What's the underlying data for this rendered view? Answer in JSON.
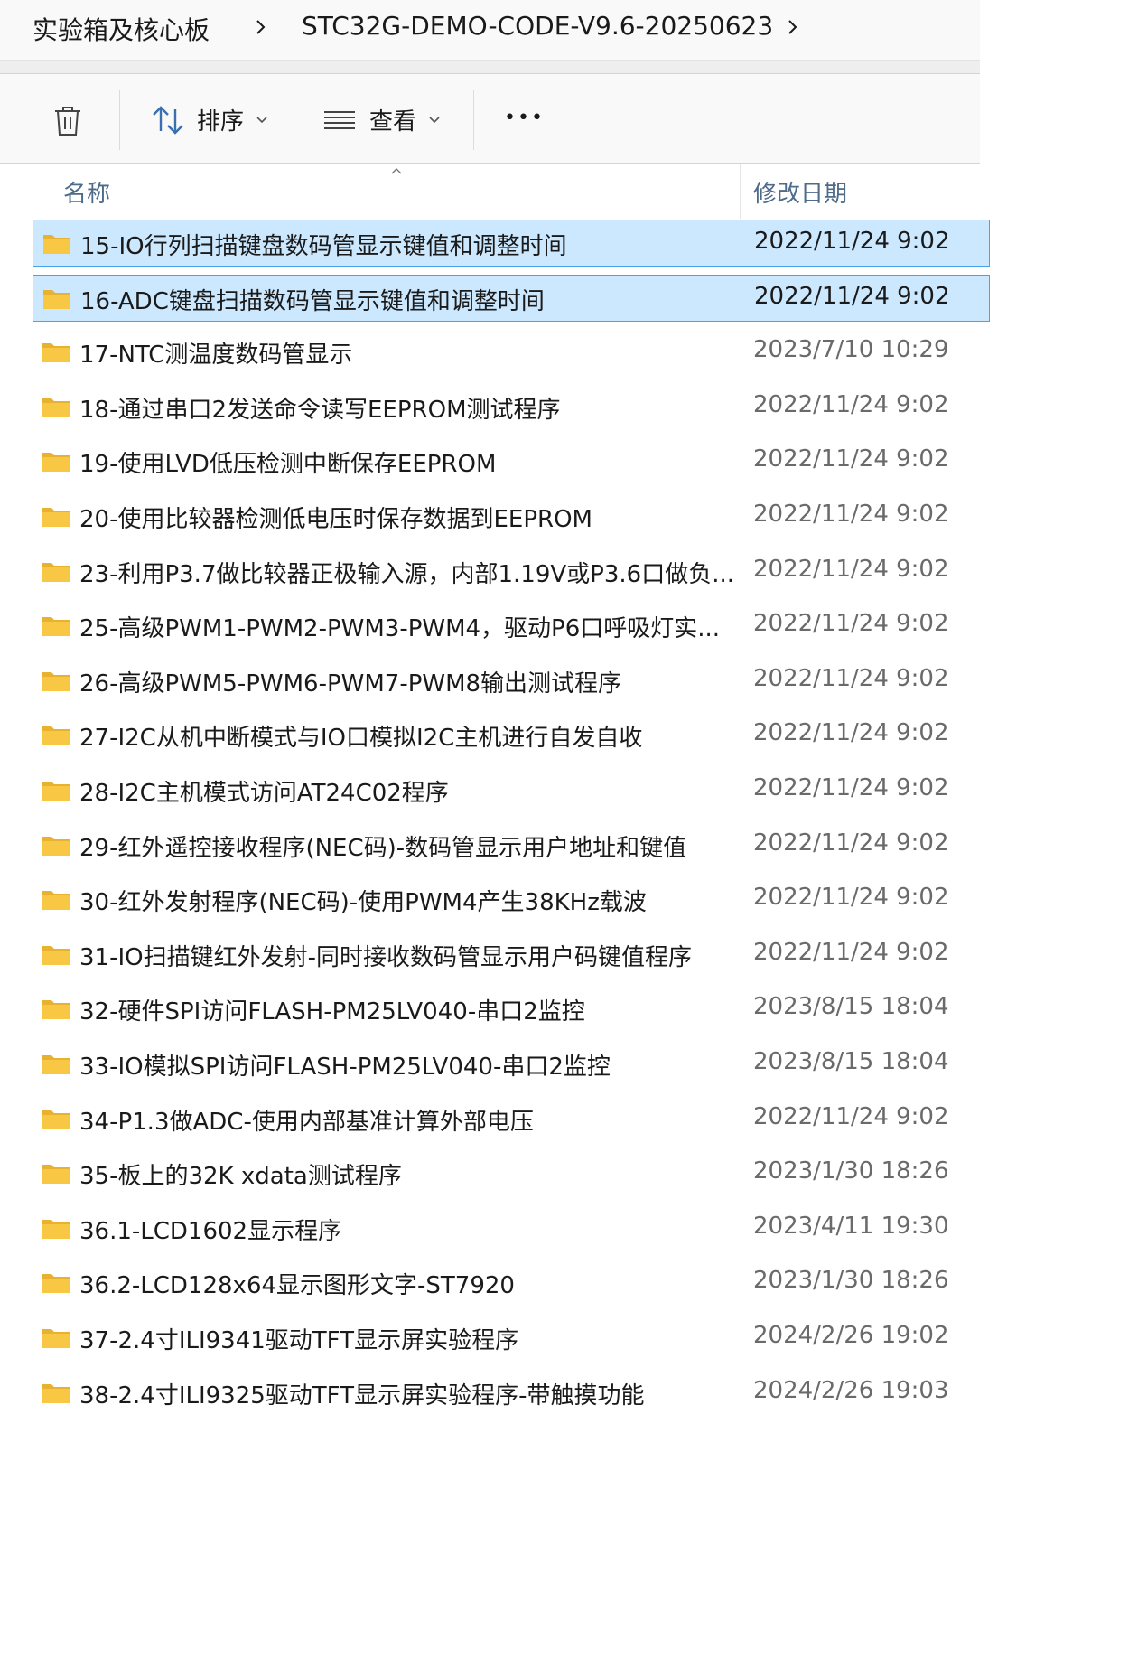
{
  "breadcrumb": {
    "items": [
      "实验箱及核心板",
      "STC32G-DEMO-CODE-V9.6-20250623"
    ]
  },
  "toolbar": {
    "sort_label": "排序",
    "view_label": "查看",
    "more_label": "•••"
  },
  "columns": {
    "name": "名称",
    "modified": "修改日期"
  },
  "colors": {
    "selected_bg": "#cce8ff",
    "selected_border": "#4aa3e8",
    "folder": "#f8c845"
  },
  "files": [
    {
      "name": "15-IO行列扫描键盘数码管显示键值和调整时间",
      "date": "2022/11/24 9:02",
      "selected": true
    },
    {
      "name": "16-ADC键盘扫描数码管显示键值和调整时间",
      "date": "2022/11/24 9:02",
      "selected": true
    },
    {
      "name": "17-NTC测温度数码管显示",
      "date": "2023/7/10 10:29",
      "selected": false
    },
    {
      "name": "18-通过串口2发送命令读写EEPROM测试程序",
      "date": "2022/11/24 9:02",
      "selected": false
    },
    {
      "name": "19-使用LVD低压检测中断保存EEPROM",
      "date": "2022/11/24 9:02",
      "selected": false
    },
    {
      "name": "20-使用比较器检测低电压时保存数据到EEPROM",
      "date": "2022/11/24 9:02",
      "selected": false
    },
    {
      "name": "23-利用P3.7做比较器正极输入源，内部1.19V或P3.6口做负...",
      "date": "2022/11/24 9:02",
      "selected": false
    },
    {
      "name": "25-高级PWM1-PWM2-PWM3-PWM4，驱动P6口呼吸灯实...",
      "date": "2022/11/24 9:02",
      "selected": false
    },
    {
      "name": "26-高级PWM5-PWM6-PWM7-PWM8输出测试程序",
      "date": "2022/11/24 9:02",
      "selected": false
    },
    {
      "name": "27-I2C从机中断模式与IO口模拟I2C主机进行自发自收",
      "date": "2022/11/24 9:02",
      "selected": false
    },
    {
      "name": "28-I2C主机模式访问AT24C02程序",
      "date": "2022/11/24 9:02",
      "selected": false
    },
    {
      "name": "29-红外遥控接收程序(NEC码)-数码管显示用户地址和键值",
      "date": "2022/11/24 9:02",
      "selected": false
    },
    {
      "name": "30-红外发射程序(NEC码)-使用PWM4产生38KHz载波",
      "date": "2022/11/24 9:02",
      "selected": false
    },
    {
      "name": "31-IO扫描键红外发射-同时接收数码管显示用户码键值程序",
      "date": "2022/11/24 9:02",
      "selected": false
    },
    {
      "name": "32-硬件SPI访问FLASH-PM25LV040-串口2监控",
      "date": "2023/8/15 18:04",
      "selected": false
    },
    {
      "name": "33-IO模拟SPI访问FLASH-PM25LV040-串口2监控",
      "date": "2023/8/15 18:04",
      "selected": false
    },
    {
      "name": "34-P1.3做ADC-使用内部基准计算外部电压",
      "date": "2022/11/24 9:02",
      "selected": false
    },
    {
      "name": "35-板上的32K xdata测试程序",
      "date": "2023/1/30 18:26",
      "selected": false
    },
    {
      "name": "36.1-LCD1602显示程序",
      "date": "2023/4/11 19:30",
      "selected": false
    },
    {
      "name": "36.2-LCD128x64显示图形文字-ST7920",
      "date": "2023/1/30 18:26",
      "selected": false
    },
    {
      "name": "37-2.4寸ILI9341驱动TFT显示屏实验程序",
      "date": "2024/2/26 19:02",
      "selected": false
    },
    {
      "name": "38-2.4寸ILI9325驱动TFT显示屏实验程序-带触摸功能",
      "date": "2024/2/26 19:03",
      "selected": false
    }
  ]
}
